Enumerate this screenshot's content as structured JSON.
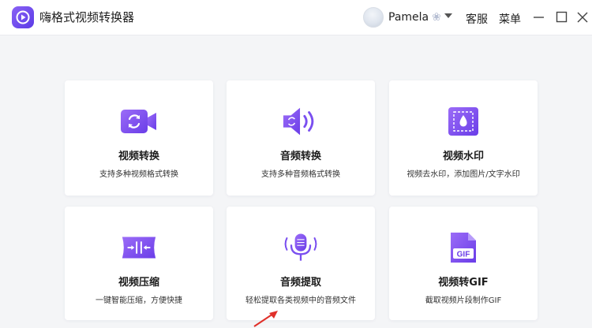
{
  "app": {
    "title": "嗨格式视频转换器",
    "accent": "#7a4ff0",
    "brand_gradient": [
      "#8a62f5",
      "#5b3be6"
    ]
  },
  "header": {
    "user_name": "Pamela",
    "vip_icon": "vip-badge-icon",
    "dropdown_icon": "caret-down-icon",
    "support_label": "客服",
    "menu_label": "菜单",
    "window_controls": [
      "minimize-icon",
      "maximize-icon",
      "close-icon"
    ]
  },
  "features": [
    {
      "title": "视频转换",
      "desc": "支持多种视频格式转换",
      "icon": "video-convert-icon"
    },
    {
      "title": "音频转换",
      "desc": "支持多种音频格式转换",
      "icon": "audio-convert-icon"
    },
    {
      "title": "视频水印",
      "desc": "视频去水印，添加图片/文字水印",
      "icon": "watermark-icon"
    },
    {
      "title": "视频压缩",
      "desc": "一键智能压缩，方便快捷",
      "icon": "compress-icon"
    },
    {
      "title": "音频提取",
      "desc": "轻松提取各类视频中的音频文件",
      "icon": "microphone-icon"
    },
    {
      "title": "视频转GIF",
      "desc": "截取视频片段制作GIF",
      "icon": "gif-file-icon"
    }
  ],
  "annotation": {
    "arrow_color": "#e0302a"
  }
}
